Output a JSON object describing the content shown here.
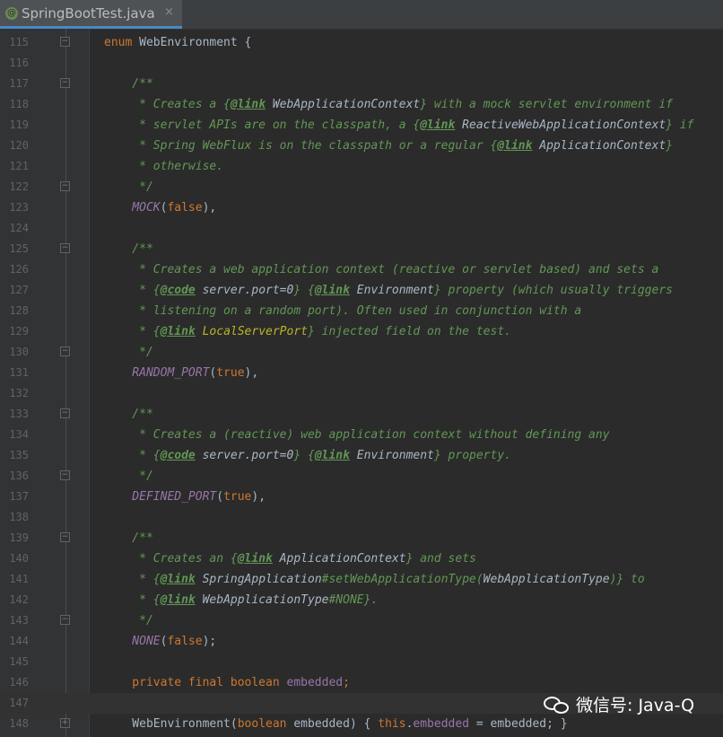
{
  "tab": {
    "icon_name": "spring-class-icon",
    "icon_glyph": "@",
    "label": "SpringBootTest.java",
    "close_glyph": "×"
  },
  "watermark": {
    "text": "微信号: Java-Q",
    "icon_name": "wechat-icon"
  },
  "lines": [
    {
      "num": "115",
      "fold": "minus",
      "segs": [
        [
          "kw",
          "enum "
        ],
        [
          "plain",
          "WebEnvironment {"
        ]
      ]
    },
    {
      "num": "116",
      "fold": "",
      "segs": []
    },
    {
      "num": "117",
      "fold": "minus",
      "segs": [
        [
          "cm",
          "    /**"
        ]
      ]
    },
    {
      "num": "118",
      "fold": "",
      "segs": [
        [
          "cm",
          "     * Creates a {"
        ],
        [
          "tag",
          "@link"
        ],
        [
          "ref",
          " WebApplicationContext"
        ],
        [
          "cm",
          "} with a mock servlet environment if"
        ]
      ]
    },
    {
      "num": "119",
      "fold": "",
      "segs": [
        [
          "cm",
          "     * servlet APIs are on the classpath, a {"
        ],
        [
          "tag",
          "@link"
        ],
        [
          "ref",
          " ReactiveWebApplicationContext"
        ],
        [
          "cm",
          "} if"
        ]
      ]
    },
    {
      "num": "120",
      "fold": "",
      "segs": [
        [
          "cm",
          "     * Spring WebFlux is on the classpath or a regular {"
        ],
        [
          "tag",
          "@link"
        ],
        [
          "ref",
          " ApplicationContext"
        ],
        [
          "cm",
          "}"
        ]
      ]
    },
    {
      "num": "121",
      "fold": "",
      "segs": [
        [
          "cm",
          "     * otherwise."
        ]
      ]
    },
    {
      "num": "122",
      "fold": "minus",
      "segs": [
        [
          "cm",
          "     */"
        ]
      ]
    },
    {
      "num": "123",
      "fold": "",
      "segs": [
        [
          "enumc",
          "    MOCK"
        ],
        [
          "plain",
          "("
        ],
        [
          "kw",
          "false"
        ],
        [
          "plain",
          "),"
        ]
      ]
    },
    {
      "num": "124",
      "fold": "",
      "segs": []
    },
    {
      "num": "125",
      "fold": "minus",
      "segs": [
        [
          "cm",
          "    /**"
        ]
      ]
    },
    {
      "num": "126",
      "fold": "",
      "segs": [
        [
          "cm",
          "     * Creates a web application context (reactive or servlet based) and sets a"
        ]
      ]
    },
    {
      "num": "127",
      "fold": "",
      "segs": [
        [
          "cm",
          "     * {"
        ],
        [
          "tag",
          "@code"
        ],
        [
          "ref",
          " server.port=0"
        ],
        [
          "cm",
          "} {"
        ],
        [
          "tag",
          "@link"
        ],
        [
          "ref",
          " Environment"
        ],
        [
          "cm",
          "} property (which usually triggers"
        ]
      ]
    },
    {
      "num": "128",
      "fold": "",
      "segs": [
        [
          "cm",
          "     * listening on a random port). Often used in conjunction with a"
        ]
      ]
    },
    {
      "num": "129",
      "fold": "",
      "segs": [
        [
          "cm",
          "     * {"
        ],
        [
          "tag",
          "@link"
        ],
        [
          "rref",
          " LocalServerPort"
        ],
        [
          "cm",
          "} injected field on the test."
        ]
      ]
    },
    {
      "num": "130",
      "fold": "minus",
      "segs": [
        [
          "cm",
          "     */"
        ]
      ]
    },
    {
      "num": "131",
      "fold": "",
      "segs": [
        [
          "enumc",
          "    RANDOM_PORT"
        ],
        [
          "plain",
          "("
        ],
        [
          "kw",
          "true"
        ],
        [
          "plain",
          "),"
        ]
      ]
    },
    {
      "num": "132",
      "fold": "",
      "segs": []
    },
    {
      "num": "133",
      "fold": "minus",
      "segs": [
        [
          "cm",
          "    /**"
        ]
      ]
    },
    {
      "num": "134",
      "fold": "",
      "segs": [
        [
          "cm",
          "     * Creates a (reactive) web application context without defining any"
        ]
      ]
    },
    {
      "num": "135",
      "fold": "",
      "segs": [
        [
          "cm",
          "     * {"
        ],
        [
          "tag",
          "@code"
        ],
        [
          "ref",
          " server.port=0"
        ],
        [
          "cm",
          "} {"
        ],
        [
          "tag",
          "@link"
        ],
        [
          "ref",
          " Environment"
        ],
        [
          "cm",
          "} property."
        ]
      ]
    },
    {
      "num": "136",
      "fold": "minus",
      "segs": [
        [
          "cm",
          "     */"
        ]
      ]
    },
    {
      "num": "137",
      "fold": "",
      "segs": [
        [
          "enumc",
          "    DEFINED_PORT"
        ],
        [
          "plain",
          "("
        ],
        [
          "kw",
          "true"
        ],
        [
          "plain",
          "),"
        ]
      ]
    },
    {
      "num": "138",
      "fold": "",
      "segs": []
    },
    {
      "num": "139",
      "fold": "minus",
      "segs": [
        [
          "cm",
          "    /**"
        ]
      ]
    },
    {
      "num": "140",
      "fold": "",
      "segs": [
        [
          "cm",
          "     * Creates an {"
        ],
        [
          "tag",
          "@link"
        ],
        [
          "ref",
          " ApplicationContext"
        ],
        [
          "cm",
          "} and sets"
        ]
      ]
    },
    {
      "num": "141",
      "fold": "",
      "segs": [
        [
          "cm",
          "     * {"
        ],
        [
          "tag",
          "@link"
        ],
        [
          "ref",
          " SpringApplication"
        ],
        [
          "cm",
          "#setWebApplicationType("
        ],
        [
          "ref",
          "WebApplicationType"
        ],
        [
          "cm",
          ")} to"
        ]
      ]
    },
    {
      "num": "142",
      "fold": "",
      "segs": [
        [
          "cm",
          "     * {"
        ],
        [
          "tag",
          "@link"
        ],
        [
          "ref",
          " WebApplicationType"
        ],
        [
          "cm",
          "#NONE}."
        ]
      ]
    },
    {
      "num": "143",
      "fold": "minus",
      "segs": [
        [
          "cm",
          "     */"
        ]
      ]
    },
    {
      "num": "144",
      "fold": "",
      "segs": [
        [
          "enumc",
          "    NONE"
        ],
        [
          "plain",
          "("
        ],
        [
          "kw",
          "false"
        ],
        [
          "plain",
          ");"
        ]
      ]
    },
    {
      "num": "145",
      "fold": "",
      "segs": []
    },
    {
      "num": "146",
      "fold": "",
      "segs": [
        [
          "kw",
          "    private final boolean "
        ],
        [
          "fld",
          "embedded"
        ],
        [
          "punc",
          ";"
        ]
      ]
    },
    {
      "num": "147",
      "fold": "",
      "current": true,
      "segs": []
    },
    {
      "num": "148",
      "fold": "plus",
      "segs": [
        [
          "plain",
          "    WebEnvironment("
        ],
        [
          "kw",
          "boolean "
        ],
        [
          "plain",
          "embedded) { "
        ],
        [
          "kw",
          "this"
        ],
        [
          "plain",
          "."
        ],
        [
          "fld",
          "embedded"
        ],
        [
          "plain",
          " = embedded; }"
        ]
      ]
    }
  ]
}
